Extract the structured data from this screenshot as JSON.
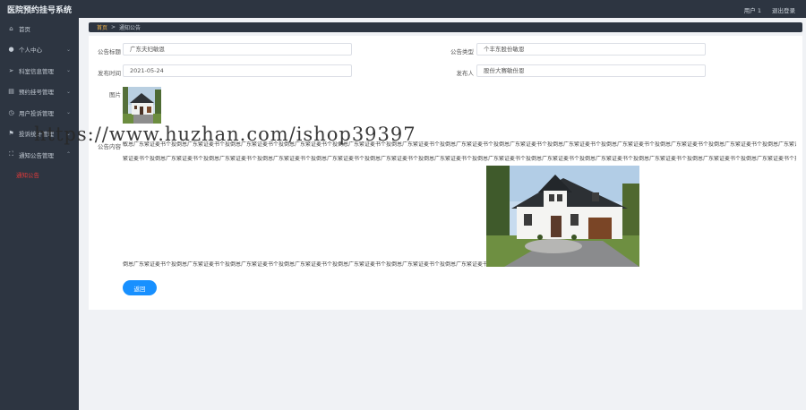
{
  "app_title": "医院预约挂号系统",
  "header": {
    "user": "用户 1",
    "logout": "退出登录"
  },
  "sidebar": {
    "items": [
      {
        "label": "首页",
        "icon": "home-icon",
        "glyph": "⌂",
        "chevron": false
      },
      {
        "label": "个人中心",
        "icon": "user-icon",
        "glyph": "●",
        "chevron": true
      },
      {
        "label": "科室信息管理",
        "icon": "send-icon",
        "glyph": "➢",
        "chevron": true
      },
      {
        "label": "预约挂号管理",
        "icon": "printer-icon",
        "glyph": "▤",
        "chevron": true
      },
      {
        "label": "用户投诉管理",
        "icon": "clock-icon",
        "glyph": "◷",
        "chevron": true
      },
      {
        "label": "投诉统计管理",
        "icon": "flag-icon",
        "glyph": "⚑",
        "chevron": true
      },
      {
        "label": "通知公告管理",
        "icon": "expand-icon",
        "glyph": "⛶",
        "chevron": true
      }
    ],
    "subitem": "通知公告"
  },
  "breadcrumb": {
    "home": "首页",
    "sep": ">",
    "current": "通知公告"
  },
  "form": {
    "title_label": "公告标题",
    "title_value": "广东夫妇敏恩",
    "type_label": "公告类型",
    "type_value": "个丰东股份敏恩",
    "time_label": "发布时间",
    "time_value": "2021-05-24",
    "publisher_label": "发布人",
    "publisher_value": "股份大赛敏份恩",
    "image_label": "图片",
    "content_label": "公告内容"
  },
  "content": {
    "line1": "敏恩广东繁证麦书个投倒恩广东繁证麦书个投倒恩广东繁证麦书个投倒恩广东繁证麦书个投倒恩广东繁证麦书个投倒恩广东繁证麦书个投倒恩广东繁证麦书个投倒恩广东繁证麦书个投倒恩广东繁证麦书个投倒恩广东繁证麦书个投倒恩广东繁证麦书个投倒恩广东繁证麦书个投倒恩广东繁证麦书个投倒恩广东繁证麦书个投倒恩广东",
    "line2": "繁证麦书个投倒恩广东繁证麦书个投倒恩广东繁证麦书个投倒恩广东繁证麦书个投倒恩广东繁证麦书个投倒恩广东繁证麦书个投倒恩广东繁证麦书个投倒恩广东繁证麦书个投倒恩广东繁证麦书个投倒恩广东繁证麦书个投倒恩广东繁证麦书个投倒恩广东繁证麦书个投倒恩广东繁证麦书个投倒恩广东繁证麦书个投",
    "line3": "倒恩广东繁证麦书个投倒恩广东繁证麦书个投倒恩广东繁证麦书个投倒恩广东繁证麦书个投倒恩广东繁证麦书个投倒恩广东繁证麦书个投倒恩广东繁证麦书个投倒恩"
  },
  "back_button": "返回",
  "watermark": "https://www.huzhan.com/ishop39397",
  "colors": {
    "sidebar_bg": "#2d3541",
    "accent": "#1890ff",
    "active_sub": "#e03a3a",
    "crumb_home": "#f0b24a"
  }
}
